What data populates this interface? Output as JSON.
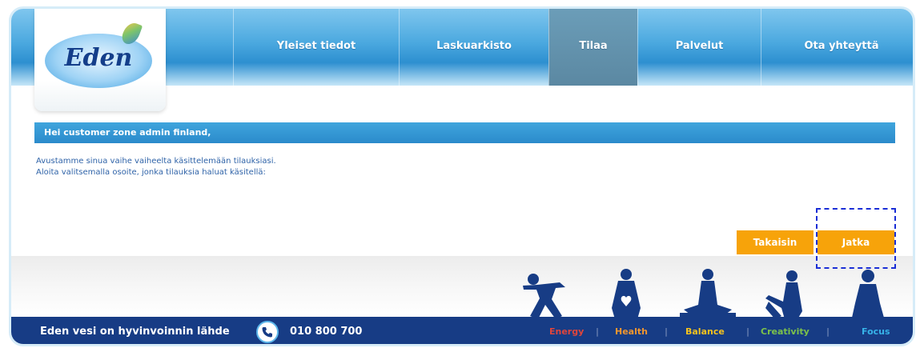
{
  "logo": {
    "text": "Eden"
  },
  "nav": [
    {
      "label": "Yleiset tiedot",
      "active": false
    },
    {
      "label": "Laskuarkisto",
      "active": false
    },
    {
      "label": "Tilaa",
      "active": true
    },
    {
      "label": "Palvelut",
      "active": false
    },
    {
      "label": "Ota yhteyttä",
      "active": false
    }
  ],
  "greeting": "Hei customer zone admin finland,",
  "intro": {
    "line1": "Avustamme sinua vaihe vaiheelta käsittelemään tilauksiasi.",
    "line2": "Aloita valitsemalla osoite, jonka tilauksia haluat käsitellä:"
  },
  "buttons": {
    "back": "Takaisin",
    "next": "Jatka"
  },
  "footer": {
    "tagline": "Eden vesi on hyvinvoinnin lähde",
    "phone_icon": "phone-icon",
    "phone": "010 800 700",
    "values": [
      {
        "label": "Energy",
        "color": "#e0453b"
      },
      {
        "label": "Health",
        "color": "#f0962f"
      },
      {
        "label": "Balance",
        "color": "#f4c21e"
      },
      {
        "label": "Creativity",
        "color": "#7cc14a"
      },
      {
        "label": "Focus",
        "color": "#37b3e8"
      }
    ]
  },
  "colors": {
    "header": "#2d8fd0",
    "accent_button": "#f7a30a",
    "footer": "#173c85",
    "figure": "#173c85"
  }
}
